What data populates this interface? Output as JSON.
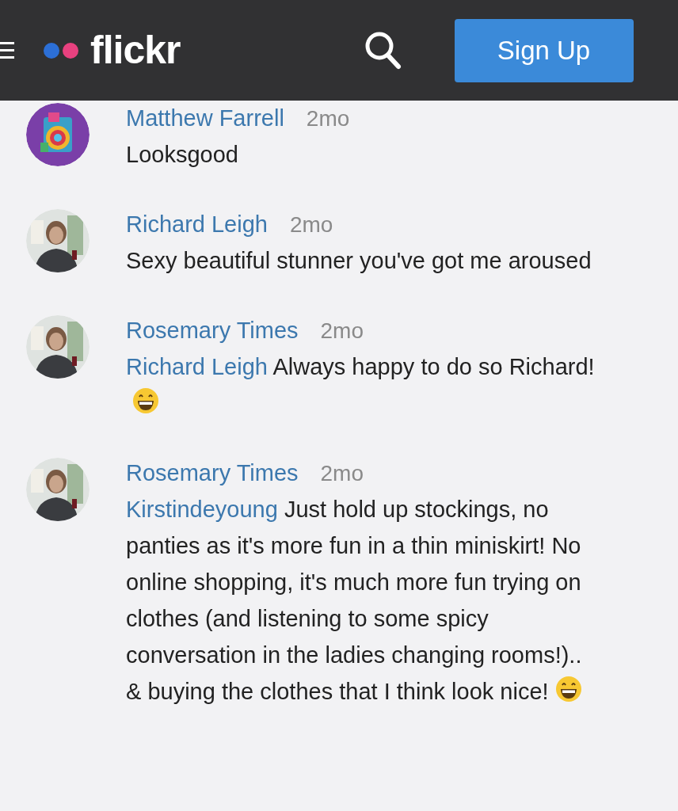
{
  "header": {
    "logo": "flickr",
    "sign_up": "Sign Up"
  },
  "comments": [
    {
      "author": "Matthew Farrell",
      "time": "2mo",
      "text": "Looksgood"
    },
    {
      "author": "Richard Leigh",
      "time": "2mo",
      "text": "Sexy beautiful stunner you've got me aroused"
    },
    {
      "author": "Rosemary Times",
      "time": "2mo",
      "mention": "Richard Leigh",
      "text": "Always happy to do so Richard!",
      "emoji": true
    },
    {
      "author": "Rosemary Times",
      "time": "2mo",
      "mention": "Kirstindeyoung",
      "text": "Just hold up stockings, no panties as it's more fun in a thin miniskirt! No online shopping, it's much more fun trying on clothes (and listening to some spicy conversation in the ladies changing rooms!).. & buying the clothes that I think look nice!",
      "emoji": true
    }
  ]
}
